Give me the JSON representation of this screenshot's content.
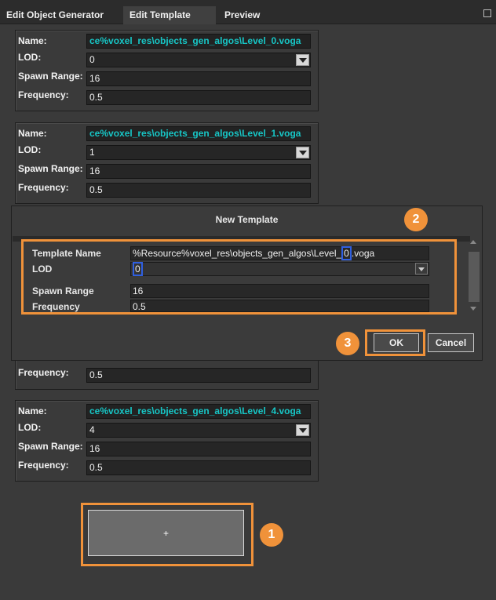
{
  "tabs": [
    {
      "label": "Edit Object Generator",
      "active": false
    },
    {
      "label": "Edit Template",
      "active": true
    },
    {
      "label": "Preview",
      "active": false
    }
  ],
  "labels": {
    "name": "Name:",
    "lod": "LOD:",
    "spawn_range": "Spawn Range:",
    "frequency": "Frequency:"
  },
  "templates": [
    {
      "name": "ce%voxel_res\\objects_gen_algos\\Level_0.voga",
      "lod": "0",
      "spawn_range": "16",
      "frequency": "0.5"
    },
    {
      "name": "ce%voxel_res\\objects_gen_algos\\Level_1.voga",
      "lod": "1",
      "spawn_range": "16",
      "frequency": "0.5"
    },
    {
      "frequency": "0.5"
    },
    {
      "name": "ce%voxel_res\\objects_gen_algos\\Level_4.voga",
      "lod": "4",
      "spawn_range": "16",
      "frequency": "0.5"
    }
  ],
  "add_button": {
    "label": "+"
  },
  "badges": {
    "one": "1",
    "two": "2",
    "three": "3"
  },
  "dialog": {
    "title": "New Template",
    "template_name_label": "Template Name",
    "template_name_value_prefix": "%Resource%voxel_res\\objects_gen_algos\\Level_",
    "template_name_value_index": "0",
    "template_name_value_suffix": ".voga",
    "lod_label": "LOD",
    "lod_value": "0",
    "spawn_range_label": "Spawn Range",
    "spawn_range_value": "16",
    "frequency_label": "Frequency",
    "frequency_value": "0.5",
    "ok_label": "OK",
    "cancel_label": "Cancel"
  },
  "colors": {
    "accent_highlight": "#f0923a",
    "blue_highlight": "#2f5fe0",
    "name_text": "#17c6c6"
  }
}
